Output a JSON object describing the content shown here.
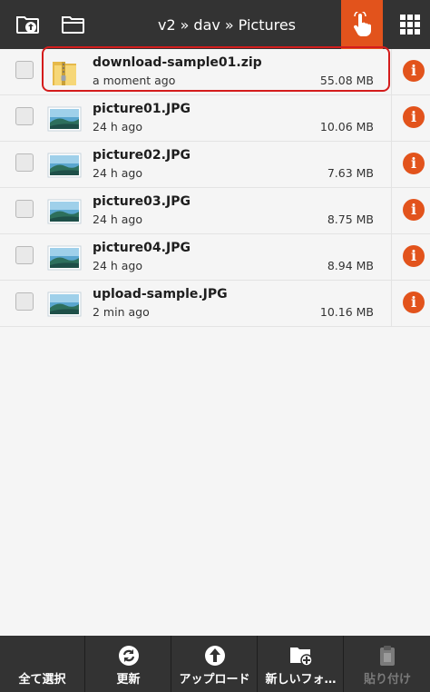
{
  "header": {
    "breadcrumb": [
      "v2",
      "dav",
      "Pictures"
    ],
    "separator": "»",
    "accent_color": "#e2531c",
    "icons": [
      "folder-upload-icon",
      "folder-icon",
      "touch-hand-icon",
      "grid-menu-icon"
    ]
  },
  "files": [
    {
      "name": "download-sample01.zip",
      "time": "a moment ago",
      "size": "55.08 MB",
      "type": "zip",
      "highlighted": true
    },
    {
      "name": "picture01.JPG",
      "time": "24 h ago",
      "size": "10.06 MB",
      "type": "image"
    },
    {
      "name": "picture02.JPG",
      "time": "24 h ago",
      "size": "7.63 MB",
      "type": "image"
    },
    {
      "name": "picture03.JPG",
      "time": "24 h ago",
      "size": "8.75 MB",
      "type": "image"
    },
    {
      "name": "picture04.JPG",
      "time": "24 h ago",
      "size": "8.94 MB",
      "type": "image"
    },
    {
      "name": "upload-sample.JPG",
      "time": "2 min ago",
      "size": "10.16 MB",
      "type": "image"
    }
  ],
  "info_glyph": "i",
  "footer": {
    "select_all": "全て選択",
    "refresh": "更新",
    "upload": "アップロード",
    "new_folder": "新しいフォ…",
    "paste": "貼り付け"
  }
}
